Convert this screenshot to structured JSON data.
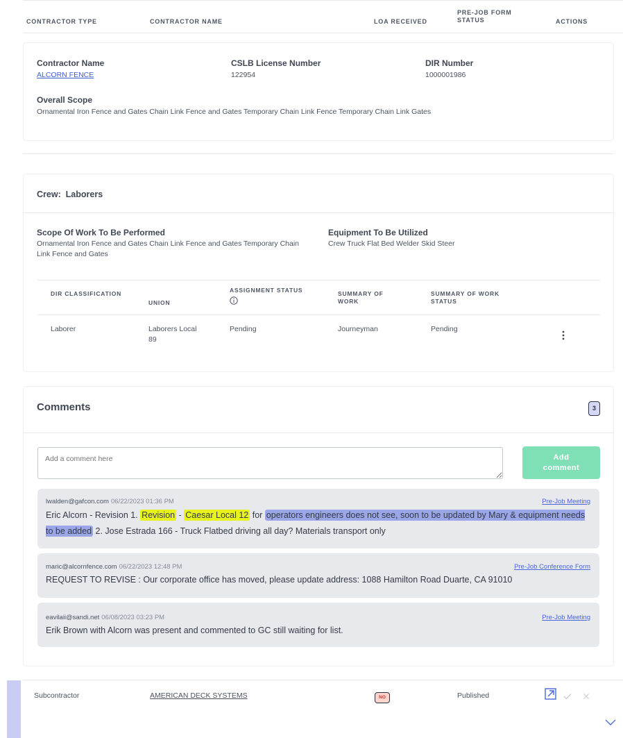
{
  "table": {
    "headers": [
      "CONTRACTOR TYPE",
      "CONTRACTOR NAME",
      "LOA RECEIVED",
      "PRE-JOB FORM STATUS",
      "ACTIONS"
    ]
  },
  "contractor": {
    "name_label": "Contractor Name",
    "name_value": "ALCORN FENCE",
    "cslb_label": "CSLB License Number",
    "cslb_value": "122954",
    "dir_label": "DIR Number",
    "dir_value": "1000001986",
    "scope_label": "Overall Scope",
    "scope_value": "Ornamental Iron Fence and Gates Chain Link Fence and Gates Temporary Chain Link Fence Temporary Chain Link Gates"
  },
  "crew": {
    "title": "Crew:  Laborers",
    "scope_label": "Scope Of Work To Be Performed",
    "scope_value": "Ornamental Iron Fence and Gates Chain Link Fence and Gates Temporary Chain Link Fence and Gates",
    "equip_label": "Equipment To Be Utilized",
    "equip_value": "Crew Truck Flat Bed Welder Skid Steer",
    "headers": [
      "DIR CLASSIFICATION",
      "UNION",
      "ASSIGNMENT STATUS",
      "SUMMARY OF WORK",
      "SUMMARY OF WORK STATUS"
    ],
    "row": {
      "classification": "Laborer",
      "union": "Laborers Local 89",
      "assignment": "Pending",
      "summary": "Journeyman",
      "summary_status": "Pending"
    }
  },
  "comments": {
    "title": "Comments",
    "count": "3",
    "placeholder": "Add a comment here",
    "add_label": "Add comment",
    "items": [
      {
        "author": "lwalden@gafcon.com",
        "date": "06/22/2023 01:36 PM",
        "tag": "Pre-Job Meeting",
        "parts": [
          "Eric Alcorn - Revision 1. ",
          "Revision",
          " - ",
          "Caesar Local 12",
          " for ",
          "operators engineers does not see, soon to be updated by Mary & equipment needs to be added",
          " 2. Jose Estrada 166 - Truck Flatbed driving all day? Materials transport only"
        ]
      },
      {
        "author": "maric@alcornfence.com",
        "date": "06/22/2023 12:48 PM",
        "tag": "Pre-Job Conference Form",
        "text": "REQUEST TO REVISE : Our corporate office has moved, please update address: 1088 Hamilton Road Duarte, CA 91010"
      },
      {
        "author": "eavilaii@sandi.net",
        "date": "06/08/2023 03:23 PM",
        "tag": "Pre-Job Meeting",
        "text": "Erik Brown with Alcorn was present and commented to GC still waiting for list."
      }
    ]
  },
  "next_row": {
    "type": "Subcontractor",
    "name": "AMERICAN DECK SYSTEMS",
    "loa": "NO",
    "status": "Published"
  },
  "colors": {
    "accent": "#3f5fd6",
    "add_button": "#7ee0b4",
    "highlight_yellow": "#e8f21b",
    "highlight_blue": "#9aa6e8",
    "row_marker": "#c9cdf4"
  }
}
